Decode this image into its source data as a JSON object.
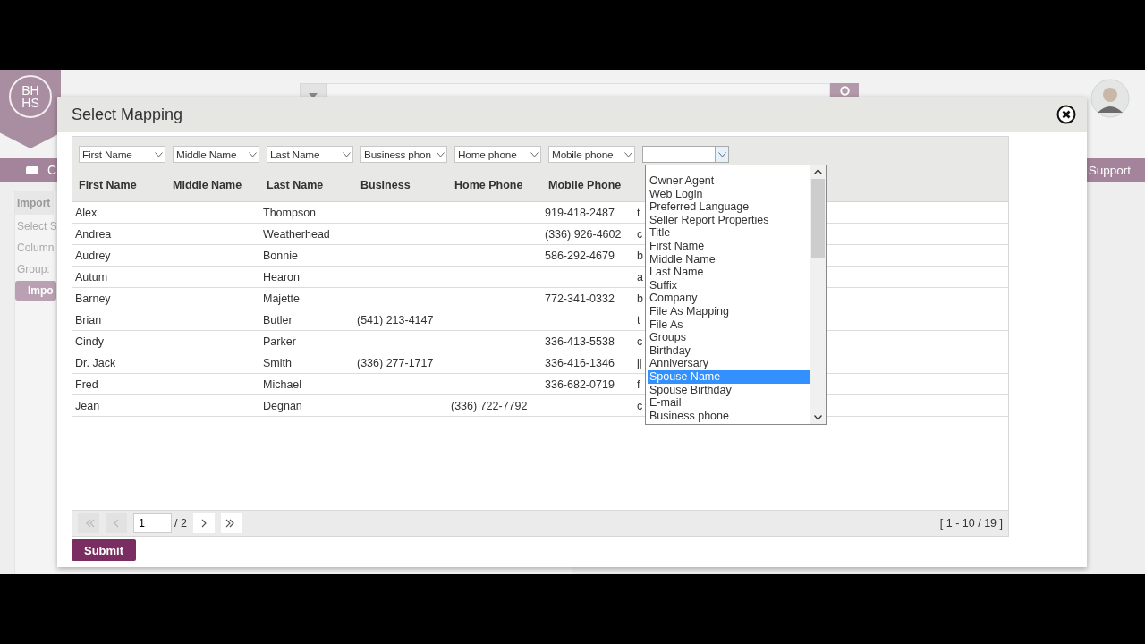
{
  "app": {
    "logo": [
      "BH",
      "HS"
    ],
    "nav": {
      "left": "C",
      "right": "Support"
    },
    "panel": {
      "title": "Import",
      "lines": [
        "Select S",
        "Column",
        "Group:"
      ],
      "button": "Impo"
    }
  },
  "modal": {
    "title": "Select Mapping",
    "mappings": [
      {
        "value": "First Name",
        "open": false
      },
      {
        "value": "Middle Name",
        "open": false
      },
      {
        "value": "Last Name",
        "open": false
      },
      {
        "value": "Business phon",
        "open": false
      },
      {
        "value": "Home phone",
        "open": false
      },
      {
        "value": "Mobile phone",
        "open": false
      },
      {
        "open": true
      }
    ],
    "dropdown": [
      {
        "label": "Owner Agent",
        "selected": false
      },
      {
        "label": "Web Login",
        "selected": false
      },
      {
        "label": "Preferred Language",
        "selected": false
      },
      {
        "label": "Seller Report Properties",
        "selected": false
      },
      {
        "label": "Title",
        "selected": false
      },
      {
        "label": "First Name",
        "selected": false
      },
      {
        "label": "Middle Name",
        "selected": false
      },
      {
        "label": "Last Name",
        "selected": false
      },
      {
        "label": "Suffix",
        "selected": false
      },
      {
        "label": "Company",
        "selected": false
      },
      {
        "label": "File As Mapping",
        "selected": false
      },
      {
        "label": "File As",
        "selected": false
      },
      {
        "label": "Groups",
        "selected": false
      },
      {
        "label": "Birthday",
        "selected": false
      },
      {
        "label": "Anniversary",
        "selected": false
      },
      {
        "label": "Spouse Name",
        "selected": true
      },
      {
        "label": "Spouse Birthday",
        "selected": false
      },
      {
        "label": "E-mail",
        "selected": false
      },
      {
        "label": "Business phone",
        "selected": false
      }
    ],
    "table": {
      "columns": [
        "First Name",
        "Middle Name",
        "Last Name",
        "Business",
        "Home Phone",
        "Mobile Phone"
      ],
      "rows": [
        [
          "Alex",
          null,
          "Thompson",
          null,
          null,
          "919-418-2487",
          "t"
        ],
        [
          "Andrea",
          null,
          "Weatherhead",
          null,
          null,
          "(336) 926-4602",
          "c"
        ],
        [
          "Audrey",
          null,
          "Bonnie",
          null,
          null,
          "586-292-4679",
          "b"
        ],
        [
          "Autum",
          null,
          "Hearon",
          null,
          null,
          null,
          "a"
        ],
        [
          "Barney",
          null,
          "Majette",
          null,
          null,
          "772-341-0332",
          "b"
        ],
        [
          "Brian",
          null,
          "Butler",
          "(541) 213-4147",
          null,
          null,
          "t"
        ],
        [
          "Cindy",
          null,
          "Parker",
          null,
          null,
          "336-413-5538",
          "c"
        ],
        [
          "Dr. Jack",
          null,
          "Smith",
          "(336) 277-1717",
          null,
          "336-416-1346",
          "jj"
        ],
        [
          "Fred",
          null,
          "Michael",
          null,
          null,
          "336-682-0719",
          "f"
        ],
        [
          "Jean",
          null,
          "Degnan",
          null,
          "(336) 722-7792",
          null,
          "c"
        ]
      ]
    },
    "pager": {
      "buttons": [
        {
          "kind": "first",
          "disabled": true
        },
        {
          "kind": "prev",
          "disabled": true
        },
        {
          "kind": "next",
          "disabled": false
        },
        {
          "kind": "last",
          "disabled": false
        }
      ],
      "page": "1",
      "total": "/ 2",
      "range": "[ 1 - 10 / 19 ]"
    },
    "submit": "Submit"
  }
}
